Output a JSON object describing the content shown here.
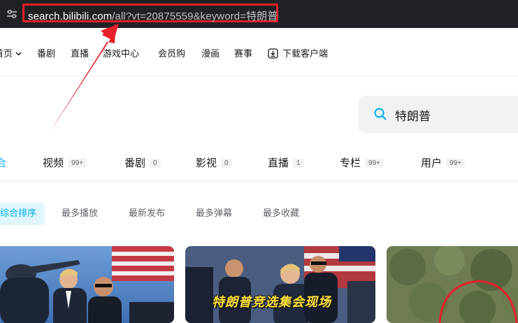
{
  "browser": {
    "url_host": "search.bilibili.com",
    "url_rest": "/all?vt=20875559&keyword=特朗普"
  },
  "nav": {
    "home": "首页",
    "items": [
      "番剧",
      "直播",
      "游戏中心",
      "会员购",
      "漫画",
      "赛事"
    ],
    "download": "下载客户端"
  },
  "search": {
    "value": "特朗普"
  },
  "tabs": [
    {
      "label": "合",
      "count": ""
    },
    {
      "label": "视频",
      "count": "99+"
    },
    {
      "label": "番剧",
      "count": "0"
    },
    {
      "label": "影视",
      "count": "0"
    },
    {
      "label": "直播",
      "count": "1"
    },
    {
      "label": "专栏",
      "count": "99+"
    },
    {
      "label": "用户",
      "count": "99+"
    }
  ],
  "sort": [
    "综合排序",
    "最多播放",
    "最新发布",
    "最多弹幕",
    "最多收藏"
  ],
  "cards": {
    "caption_2": "特朗普竞选集会现场"
  },
  "colors": {
    "accent": "#00aeec",
    "annotation": "#e5202b",
    "browser_bg": "#202124"
  }
}
